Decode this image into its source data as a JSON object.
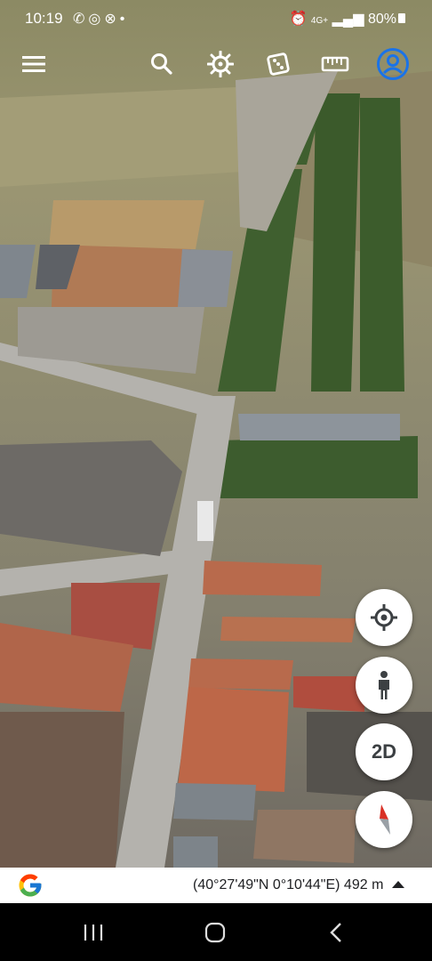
{
  "status_bar": {
    "time": "10:19",
    "network": "4G+",
    "battery": "80%",
    "left_icons": [
      "missed-call-icon",
      "whatsapp-icon",
      "shield-icon",
      "dot-icon"
    ]
  },
  "toolbar": {
    "icons": [
      "menu-icon",
      "search-icon",
      "voyager-wheel-icon",
      "dice-icon",
      "ruler-icon",
      "account-icon"
    ],
    "accent": "#1a73e8"
  },
  "map_controls": {
    "two_d_label": "2D"
  },
  "info_bar": {
    "coordinates": "(40°27'49\"N 0°10'44\"E) 492 m"
  },
  "colors": {
    "roof": "#b86a4c",
    "tree": "#3f5f2f",
    "road": "#b4b2ad"
  }
}
